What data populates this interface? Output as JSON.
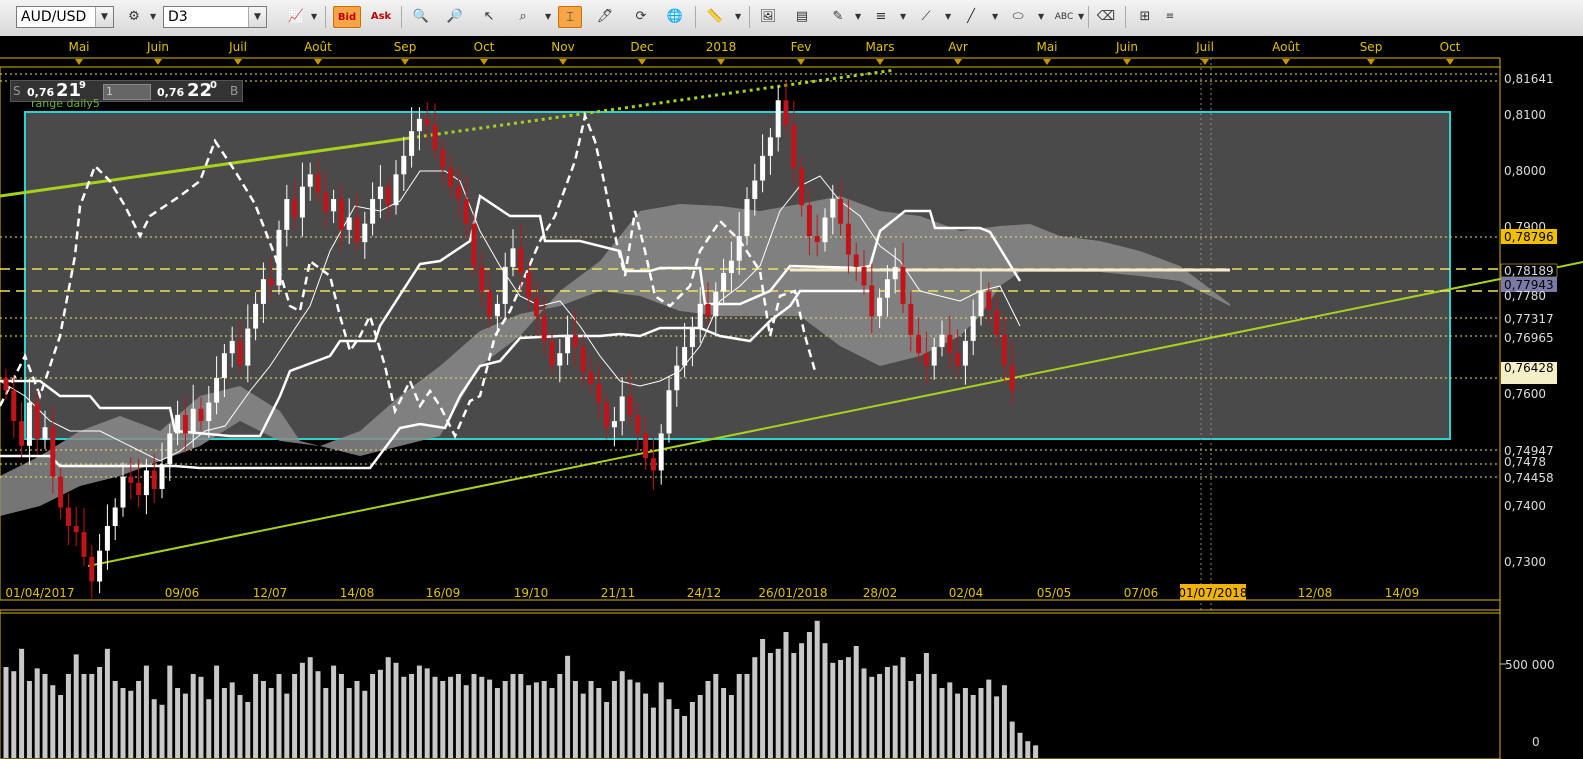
{
  "toolbar": {
    "symbol": "AUD/USD",
    "period": "D3",
    "bid_label": "Bid",
    "ask_label": "Ask"
  },
  "quote": {
    "sell_letter": "S",
    "sell_prefix": "0,76",
    "sell_big": "21",
    "sell_sup": "9",
    "qty": "1",
    "buy_prefix": "0,76",
    "buy_big": "22",
    "buy_sup": "0",
    "buy_letter": "B",
    "chart_note": "range daily5"
  },
  "months_top": [
    "Mai",
    "Juin",
    "Juil",
    "Août",
    "Sep",
    "Oct",
    "Nov",
    "Dec",
    "2018",
    "Fev",
    "Mars",
    "Avr",
    "Mai",
    "Juin",
    "Juil",
    "Août",
    "Sep",
    "Oct"
  ],
  "dates_bottom": [
    "01/04/2017",
    "09/06",
    "12/07",
    "14/08",
    "16/09",
    "19/10",
    "21/11",
    "24/12",
    "26/01/2018",
    "28/02",
    "02/04",
    "05/05",
    "07/06",
    "01/07/2018",
    "12/08",
    "14/09"
  ],
  "price_axis": [
    "0,8164",
    "0,8100",
    "0,8000",
    "0,7900",
    "0,7879",
    "0,7818",
    "0,7794",
    "0,7731",
    "0,7696",
    "0,7642",
    "0,7600",
    "0,7494",
    "0,7445",
    "0,7400",
    "0,7300"
  ],
  "price_axis_labels": {
    "p8164": "0,81641",
    "p8100": "0,8100",
    "p8000": "0,8000",
    "p7900": "0,7900",
    "p78796": "0,78796",
    "p78189": "0,78189",
    "p77943": "0,77943",
    "p7780": "0,7780",
    "p77317": "0,77317",
    "p76965": "0,76965",
    "p76428": "0,76428",
    "p7600": "0,7600",
    "p74947": "0,74947",
    "p7478": "0,7478",
    "p74458": "0,74458",
    "p7400": "0,7400",
    "p7300": "0,7300"
  },
  "volume_axis": {
    "v500k": "500 000",
    "v0": "0"
  },
  "colors": {
    "up": "#ffffff",
    "down": "#c0141b",
    "trendline": "#a6d21e",
    "box": "#27d3d3",
    "dash_yellow": "#f0e060",
    "highlight_date": "#f0b400"
  }
}
